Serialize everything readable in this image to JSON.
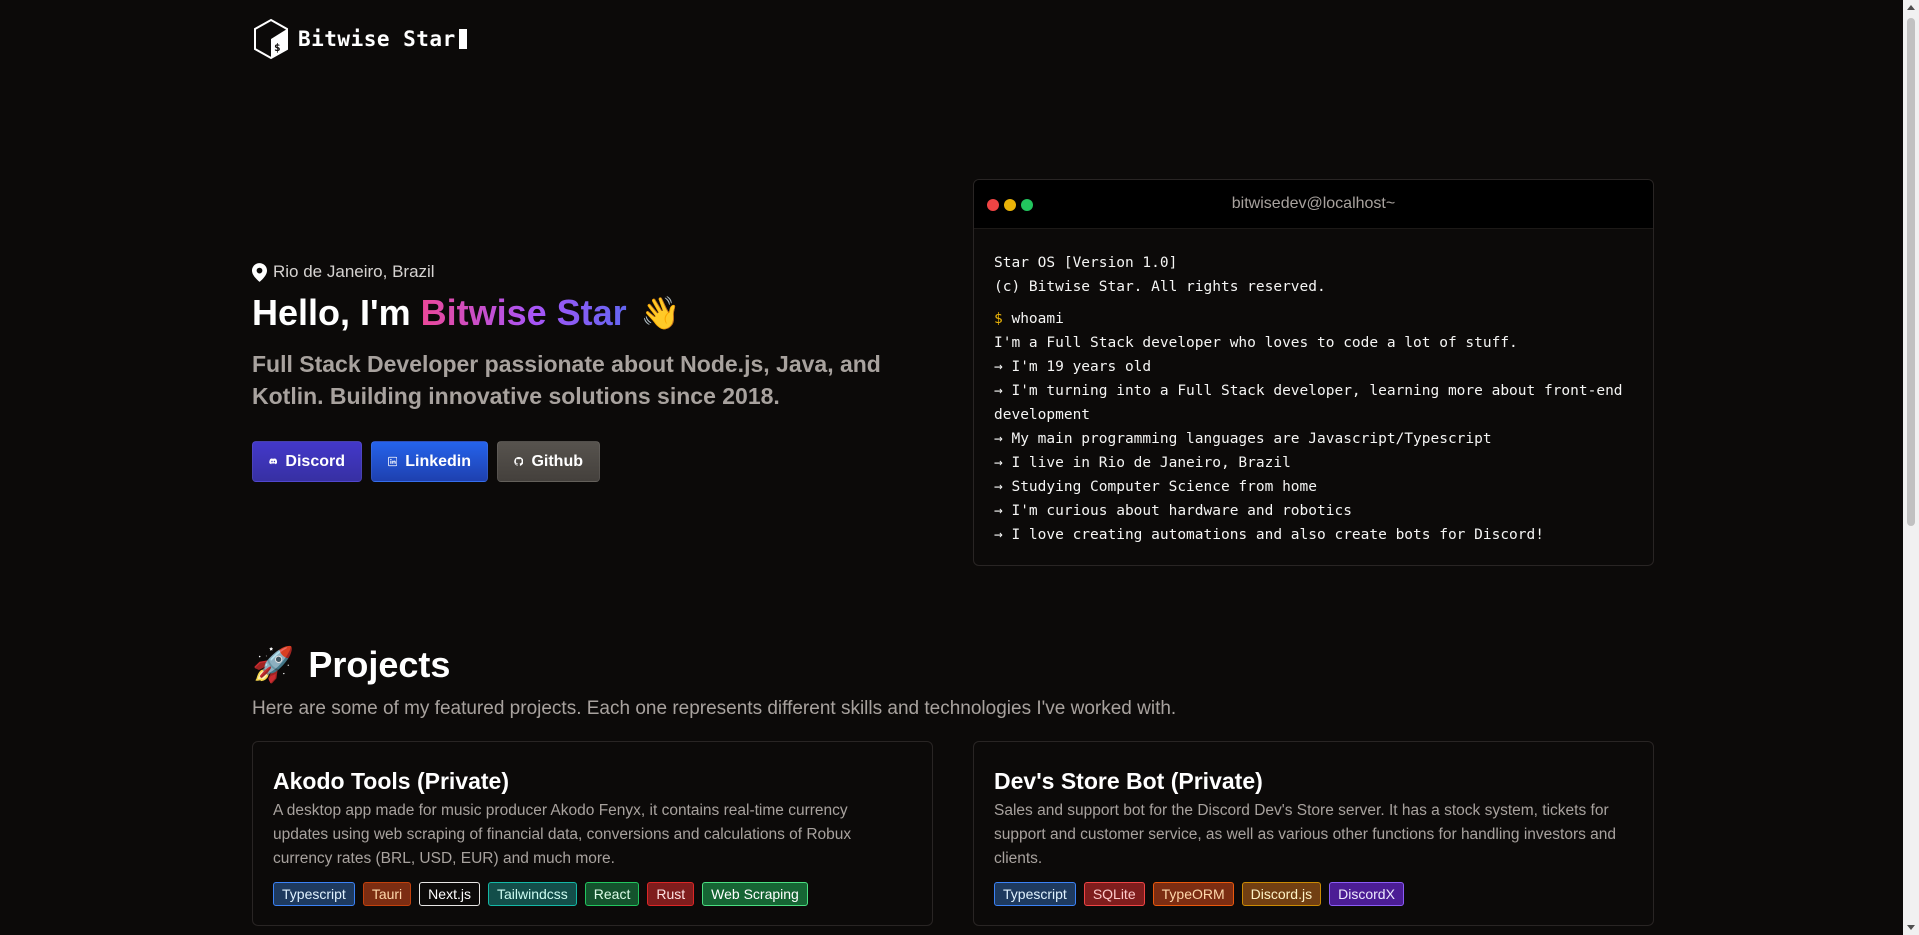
{
  "header": {
    "brand_name": "Bitwise Star"
  },
  "hero": {
    "location": "Rio de Janeiro, Brazil",
    "greeting_prefix": "Hello, I'm ",
    "greeting_name": "Bitwise Star",
    "greeting_emoji": "👋",
    "tagline": "Full Stack Developer passionate about Node.js, Java, and Kotlin. Building innovative solutions since 2018.",
    "socials": [
      {
        "label": "Discord",
        "icon": "discord-icon"
      },
      {
        "label": "Linkedin",
        "icon": "linkedin-icon"
      },
      {
        "label": "Github",
        "icon": "github-icon"
      }
    ]
  },
  "terminal": {
    "title": "bitwisedev@localhost~",
    "header_lines": [
      "Star OS [Version 1.0]",
      "(c) Bitwise Star. All rights reserved."
    ],
    "prompt_symbol": "$",
    "command": "whoami",
    "output": [
      "I'm a Full Stack developer who loves to code a lot of stuff.",
      "→ I'm 19 years old",
      "→ I'm turning into a Full Stack developer, learning more about front-end development",
      "→ My main programming languages are Javascript/Typescript",
      "→ I live in Rio de Janeiro, Brazil",
      "→ Studying Computer Science from home",
      "→ I'm curious about hardware and robotics",
      "→ I love creating automations and also create bots for Discord!"
    ]
  },
  "projects": {
    "icon": "🚀",
    "title": "Projects",
    "subtitle": "Here are some of my featured projects. Each one represents different skills and technologies I've worked with.",
    "items": [
      {
        "title": "Akodo Tools (Private)",
        "description": "A desktop app made for music producer Akodo Fenyx, it contains real-time currency updates using web scraping of financial data, conversions and calculations of Robux currency rates (BRL, USD, EUR) and much more.",
        "tags": [
          "Typescript",
          "Tauri",
          "Next.js",
          "Tailwindcss",
          "React",
          "Rust",
          "Web Scraping"
        ]
      },
      {
        "title": "Dev's Store Bot (Private)",
        "description": "Sales and support bot for the Discord Dev's Store server. It has a stock system, tickets for support and customer service, as well as various other functions for handling investors and clients.",
        "tags": [
          "Typescript",
          "SQLite",
          "TypeORM",
          "Discord.js",
          "DiscordX"
        ]
      }
    ]
  }
}
